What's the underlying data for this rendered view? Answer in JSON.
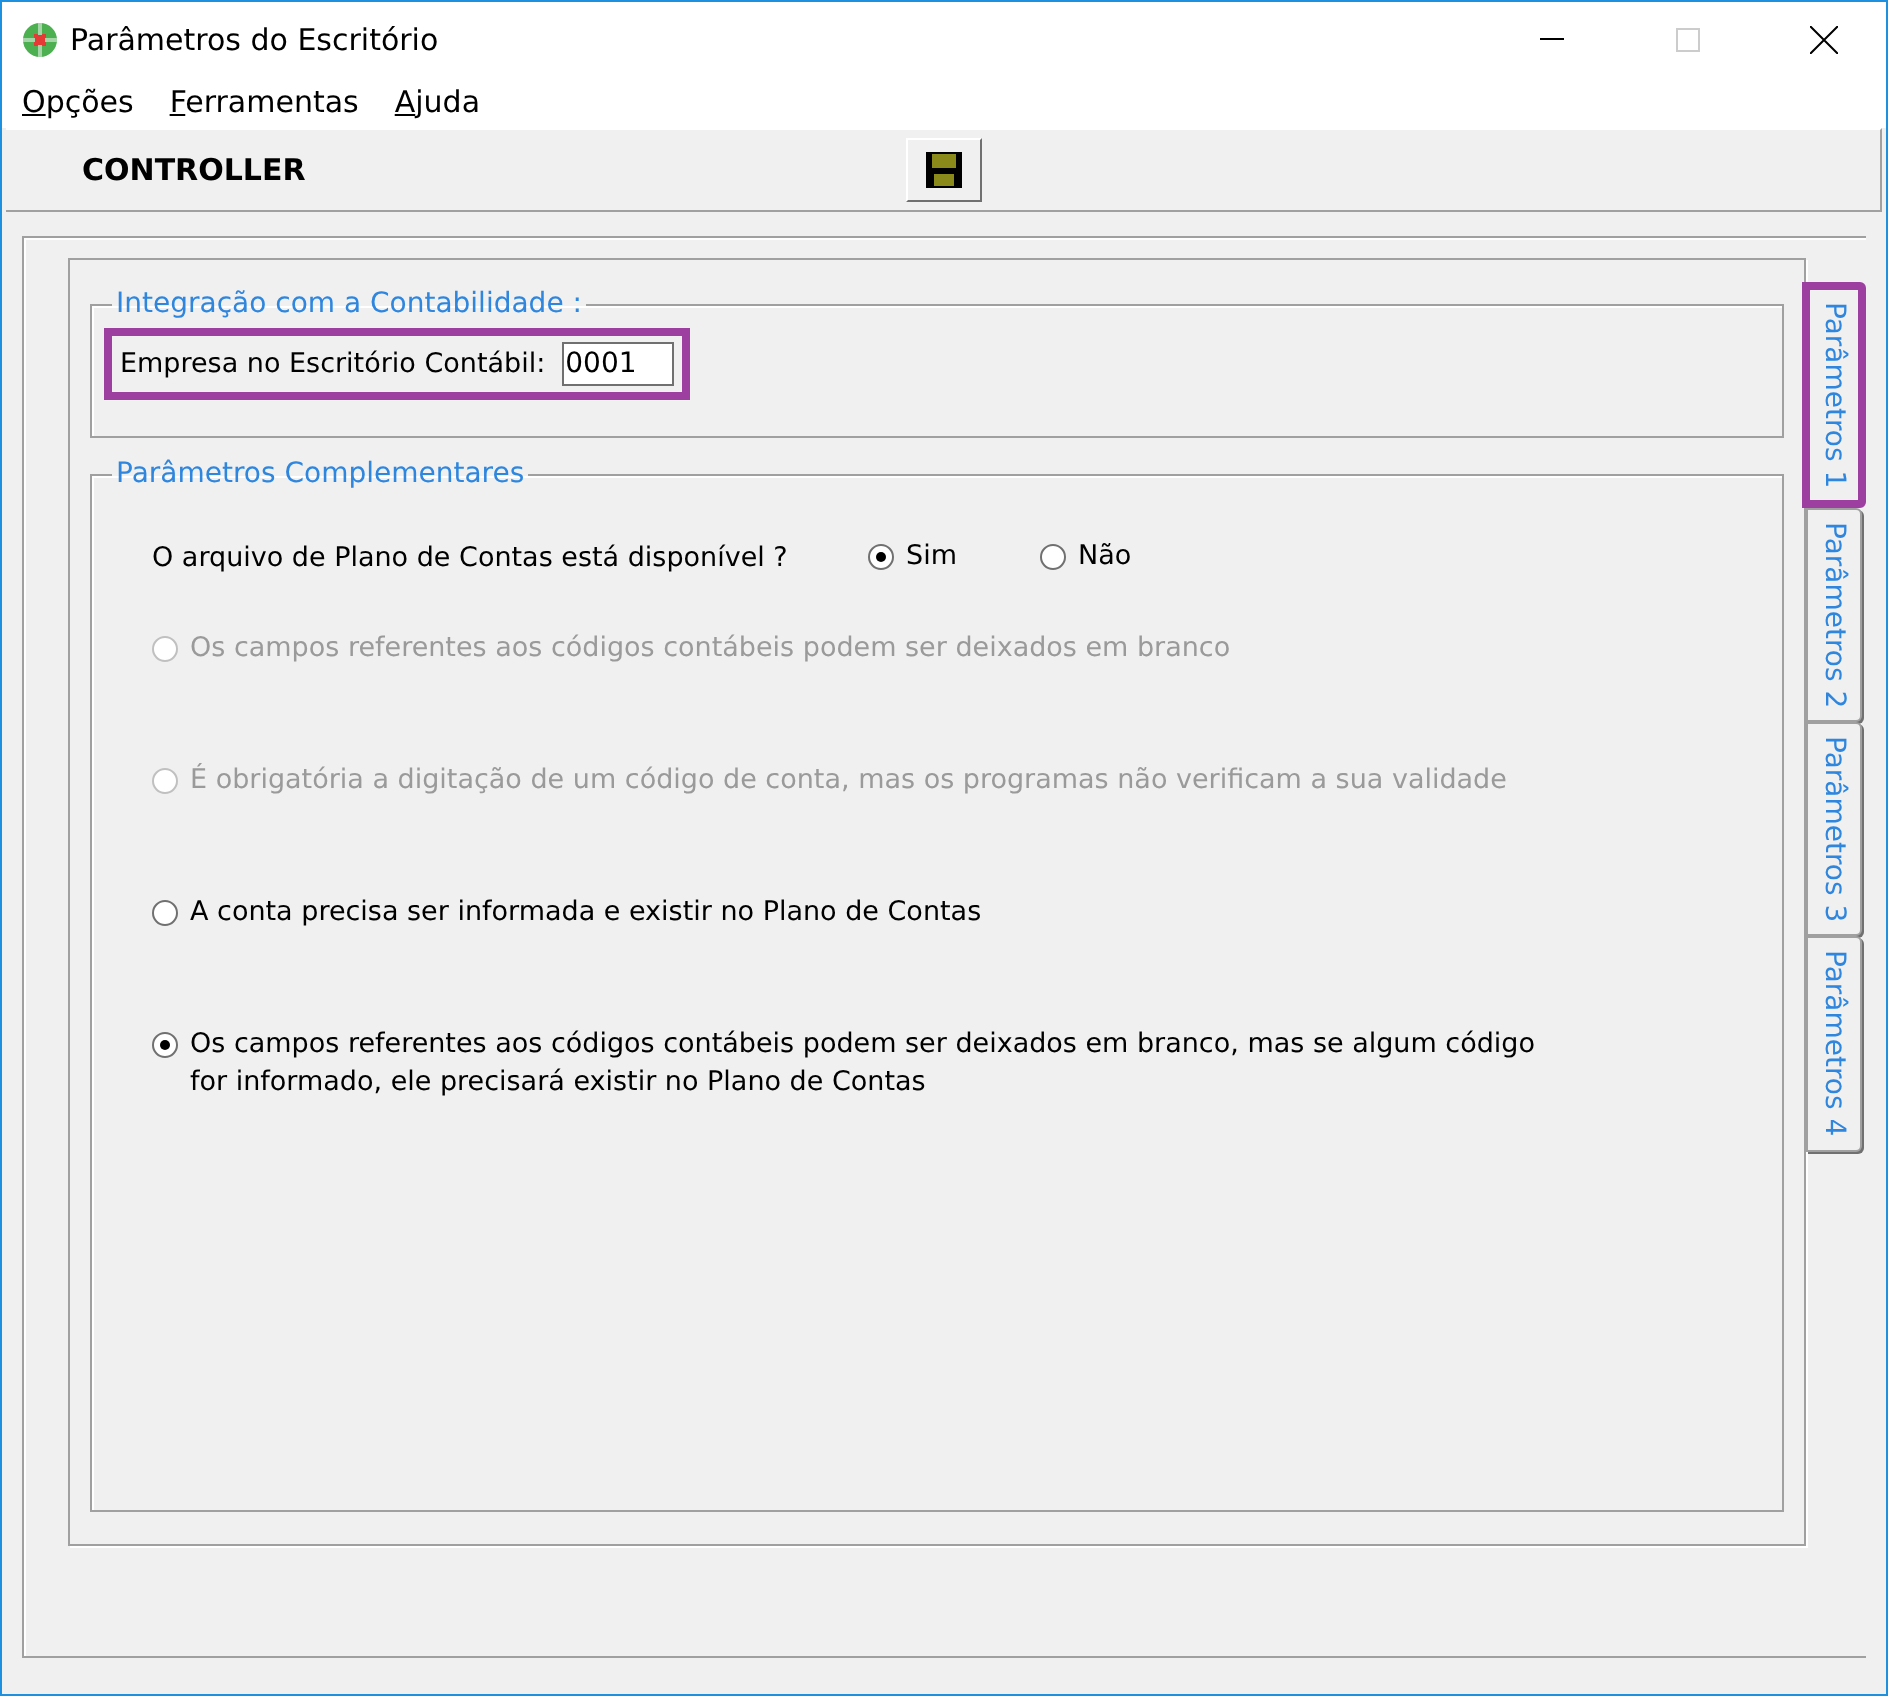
{
  "window": {
    "title": "Parâmetros do Escritório"
  },
  "menu": [
    {
      "label": "Opções"
    },
    {
      "label": "Ferramentas"
    },
    {
      "label": "Ajuda"
    }
  ],
  "toolbar": {
    "title": "CONTROLLER"
  },
  "integration": {
    "legend": "Integração com a Contabilidade :",
    "field_label": "Empresa no Escritório Contábil:",
    "value": "0001",
    "highlighted": true
  },
  "complementary": {
    "legend": "Parâmetros Complementares",
    "question": "O arquivo de Plano de Contas está disponível ?",
    "answers": [
      {
        "label": "Sim",
        "selected": true
      },
      {
        "label": "Não",
        "selected": false
      }
    ],
    "options": [
      {
        "label": "Os campos referentes aos códigos contábeis podem ser deixados em branco",
        "selected": false,
        "disabled": true
      },
      {
        "label": "É obrigatória a digitação de um código de conta, mas os programas não verificam a sua validade",
        "selected": false,
        "disabled": true
      },
      {
        "label": "A conta precisa ser informada e existir no Plano de Contas",
        "selected": false,
        "disabled": false
      },
      {
        "label": "Os campos referentes aos códigos contábeis podem ser deixados em branco, mas se algum código for informado, ele precisará existir no Plano de Contas",
        "selected": true,
        "disabled": false
      }
    ]
  },
  "tabs": [
    {
      "label": "Parâmetros 1",
      "selected": true,
      "highlighted": true
    },
    {
      "label": "Parâmetros 2",
      "selected": false,
      "highlighted": false
    },
    {
      "label": "Parâmetros 3",
      "selected": false,
      "highlighted": false
    },
    {
      "label": "Parâmetros 4",
      "selected": false,
      "highlighted": false
    }
  ]
}
